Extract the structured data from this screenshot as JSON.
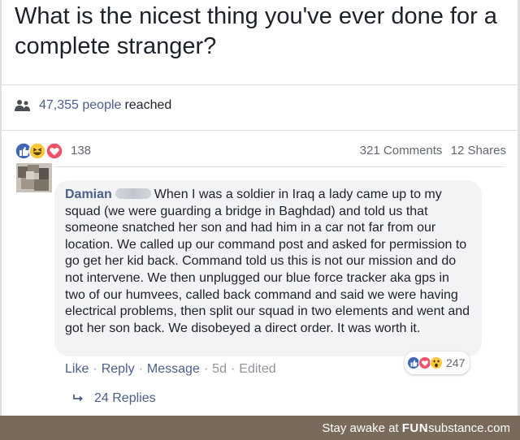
{
  "post": {
    "title": "What is the nicest thing you've ever done for a complete stranger?"
  },
  "reach": {
    "count": "47,355 people",
    "suffix": "reached",
    "icon": "people-icon"
  },
  "reactions": {
    "icons": [
      "like-icon",
      "haha-icon",
      "love-icon"
    ],
    "count": "138",
    "comments": "321 Comments",
    "shares": "12 Shares"
  },
  "comment": {
    "author": "Damian",
    "text": "When I was a soldier in Iraq a lady came up to my squad (we were guarding a bridge in Baghdad) and told us that someone snatched her son and had him in a car not far from our location. We called up our command post and asked for permission to go get her kid back. Command told us this is not our mission and do not intervene. We then unplugged our blue force tracker aka gps in two of our humvees, called back command and said we were having electrical problems, then split our squad in two elements and went and got her son back. We disobeyed a direct order. It was worth it.",
    "reactions_count": "247",
    "actions": {
      "like": "Like",
      "reply": "Reply",
      "message": "Message",
      "time": "5d",
      "edited": "Edited",
      "separator": "·"
    },
    "replies": "24 Replies"
  },
  "watermark": {
    "prefix": "Stay awake at",
    "brand_bold": "FUN",
    "brand_rest": "substance",
    "domain": ".com"
  },
  "colors": {
    "link": "#4b5f8a",
    "muted": "#90949c",
    "bubble": "#f2f3f5",
    "like_blue": "#4267b2",
    "love_red": "#f25268",
    "haha_yellow": "#f7c83c",
    "footer": "#7a6a5c"
  }
}
